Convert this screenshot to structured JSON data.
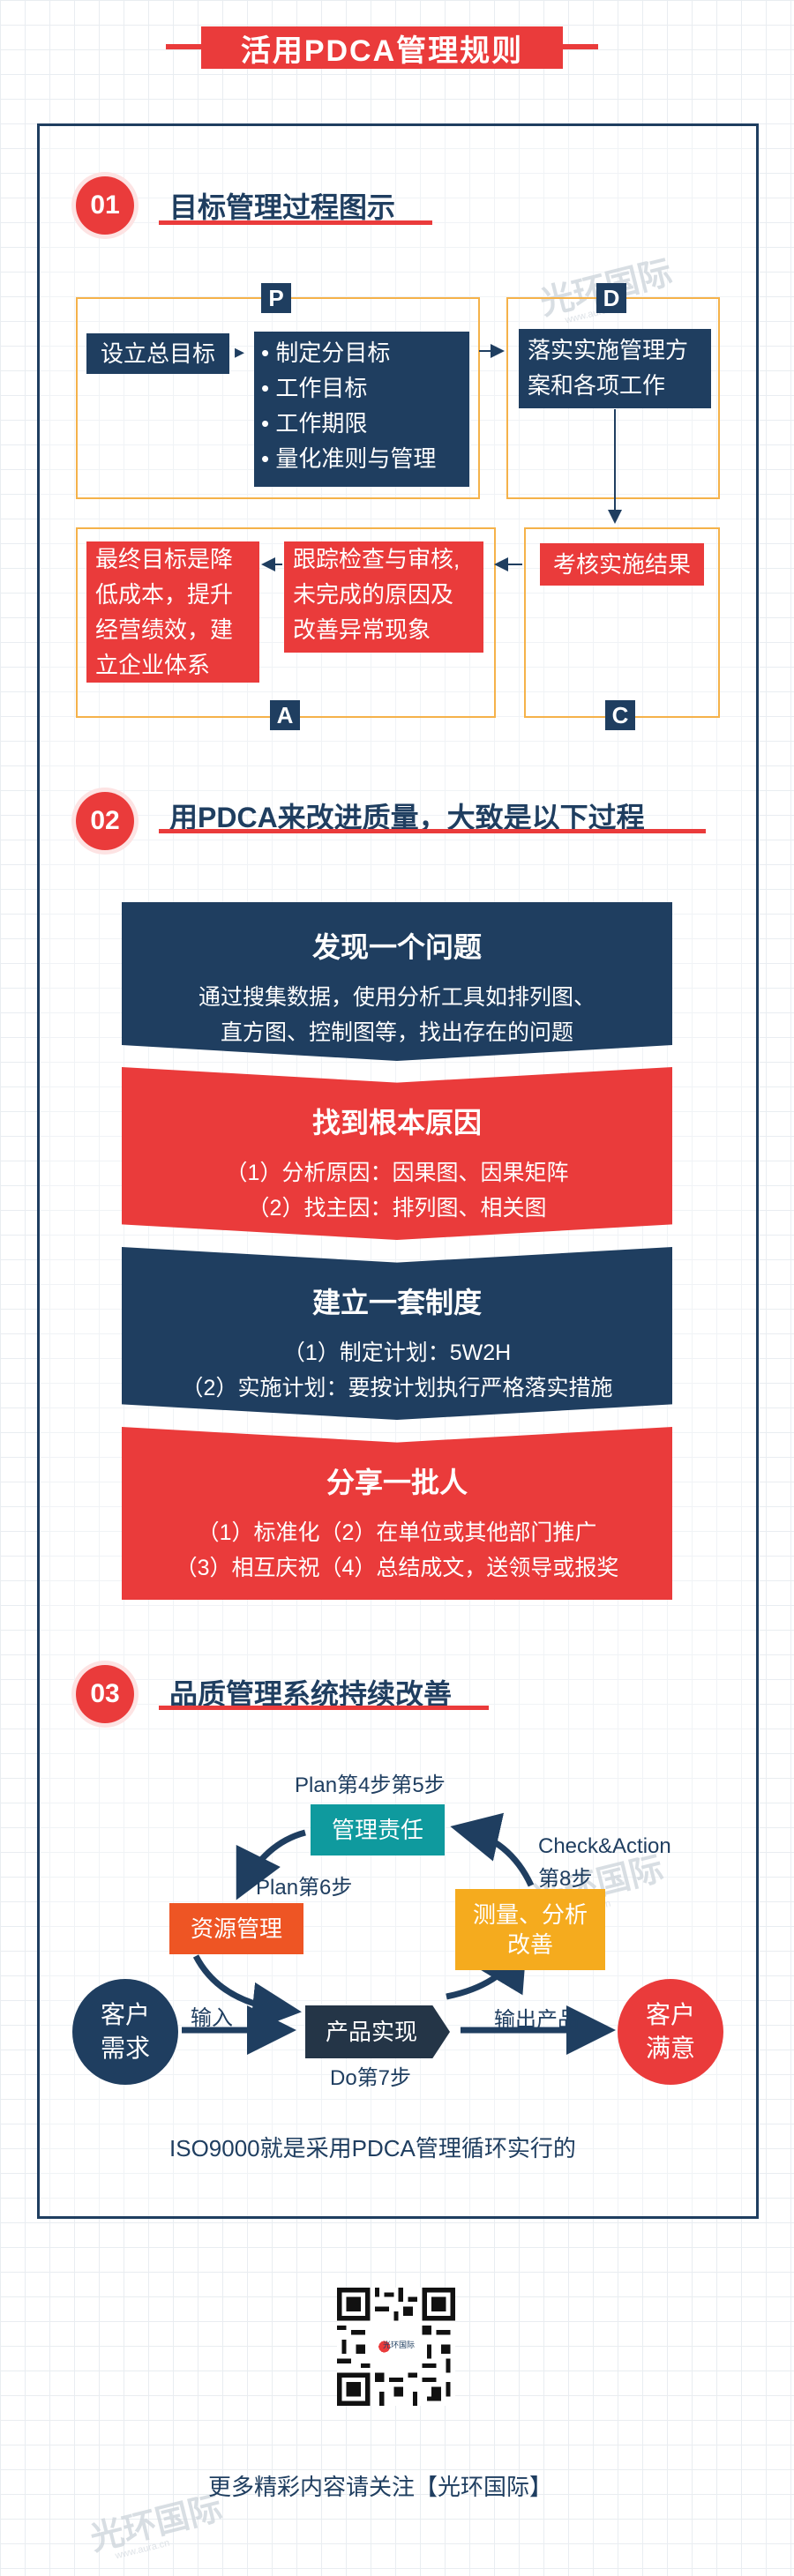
{
  "title": "活用PDCA管理规则",
  "watermark": "光环国际",
  "watermark_sub": "www.aura.cn",
  "section1": {
    "num": "01",
    "title": "目标管理过程图示",
    "letters": {
      "p": "P",
      "d": "D",
      "c": "C",
      "a": "A"
    },
    "p_box": "设立总目标",
    "p_list": [
      "制定分目标",
      "工作目标",
      "工作期限",
      "量化准则与管理"
    ],
    "d_box": [
      "落实实施管理方",
      "案和各项工作"
    ],
    "c_box": "考核实施结果",
    "a_mid": [
      "跟踪检查与审核,",
      "未完成的原因及",
      "改善异常现象"
    ],
    "a_left": [
      "最终目标是降",
      "低成本，提升",
      "经营绩效，建",
      "立企业体系"
    ]
  },
  "section2": {
    "num": "02",
    "title": "用PDCA来改进质量，大致是以下过程",
    "steps": [
      {
        "heading": "发现一个问题",
        "lines": [
          "通过搜集数据，使用分析工具如排列图、",
          "直方图、控制图等，找出存在的问题"
        ]
      },
      {
        "heading": "找到根本原因",
        "lines": [
          "（1）分析原因：因果图、因果矩阵",
          "（2）找主因：排列图、相关图"
        ]
      },
      {
        "heading": "建立一套制度",
        "lines": [
          "（1）制定计划：5W2H",
          "（2）实施计划：要按计划执行严格落实措施"
        ]
      },
      {
        "heading": "分享一批人",
        "lines": [
          "（1）标准化（2）在单位或其他部门推广",
          "（3）相互庆祝（4）总结成文，送领导或报奖"
        ]
      }
    ]
  },
  "section3": {
    "num": "03",
    "title": "品质管理系统持续改善",
    "plan45": "Plan第4步第5步",
    "duty": "管理责任",
    "check_action": "Check&Action",
    "step8": "第8步",
    "plan6": "Plan第6步",
    "resource": "资源管理",
    "measure": [
      "测量、分析",
      "改善"
    ],
    "customer_left": [
      "客户",
      "需求"
    ],
    "input": "输入",
    "product": "产品实现",
    "output": "输出产品",
    "customer_right": [
      "客户",
      "满意"
    ],
    "do7": "Do第7步",
    "footer_note": "ISO9000就是采用PDCA管理循环实行的"
  },
  "qr_logo": "光环国际",
  "follow": "更多精彩内容请关注【光环国际】",
  "colors": {
    "navy": "#1f3e60",
    "red": "#ea3b3b",
    "teal": "#0f9a9e",
    "orange_red": "#ee5524",
    "amber": "#f5ab1e",
    "outline_orange": "#f5b24a"
  }
}
